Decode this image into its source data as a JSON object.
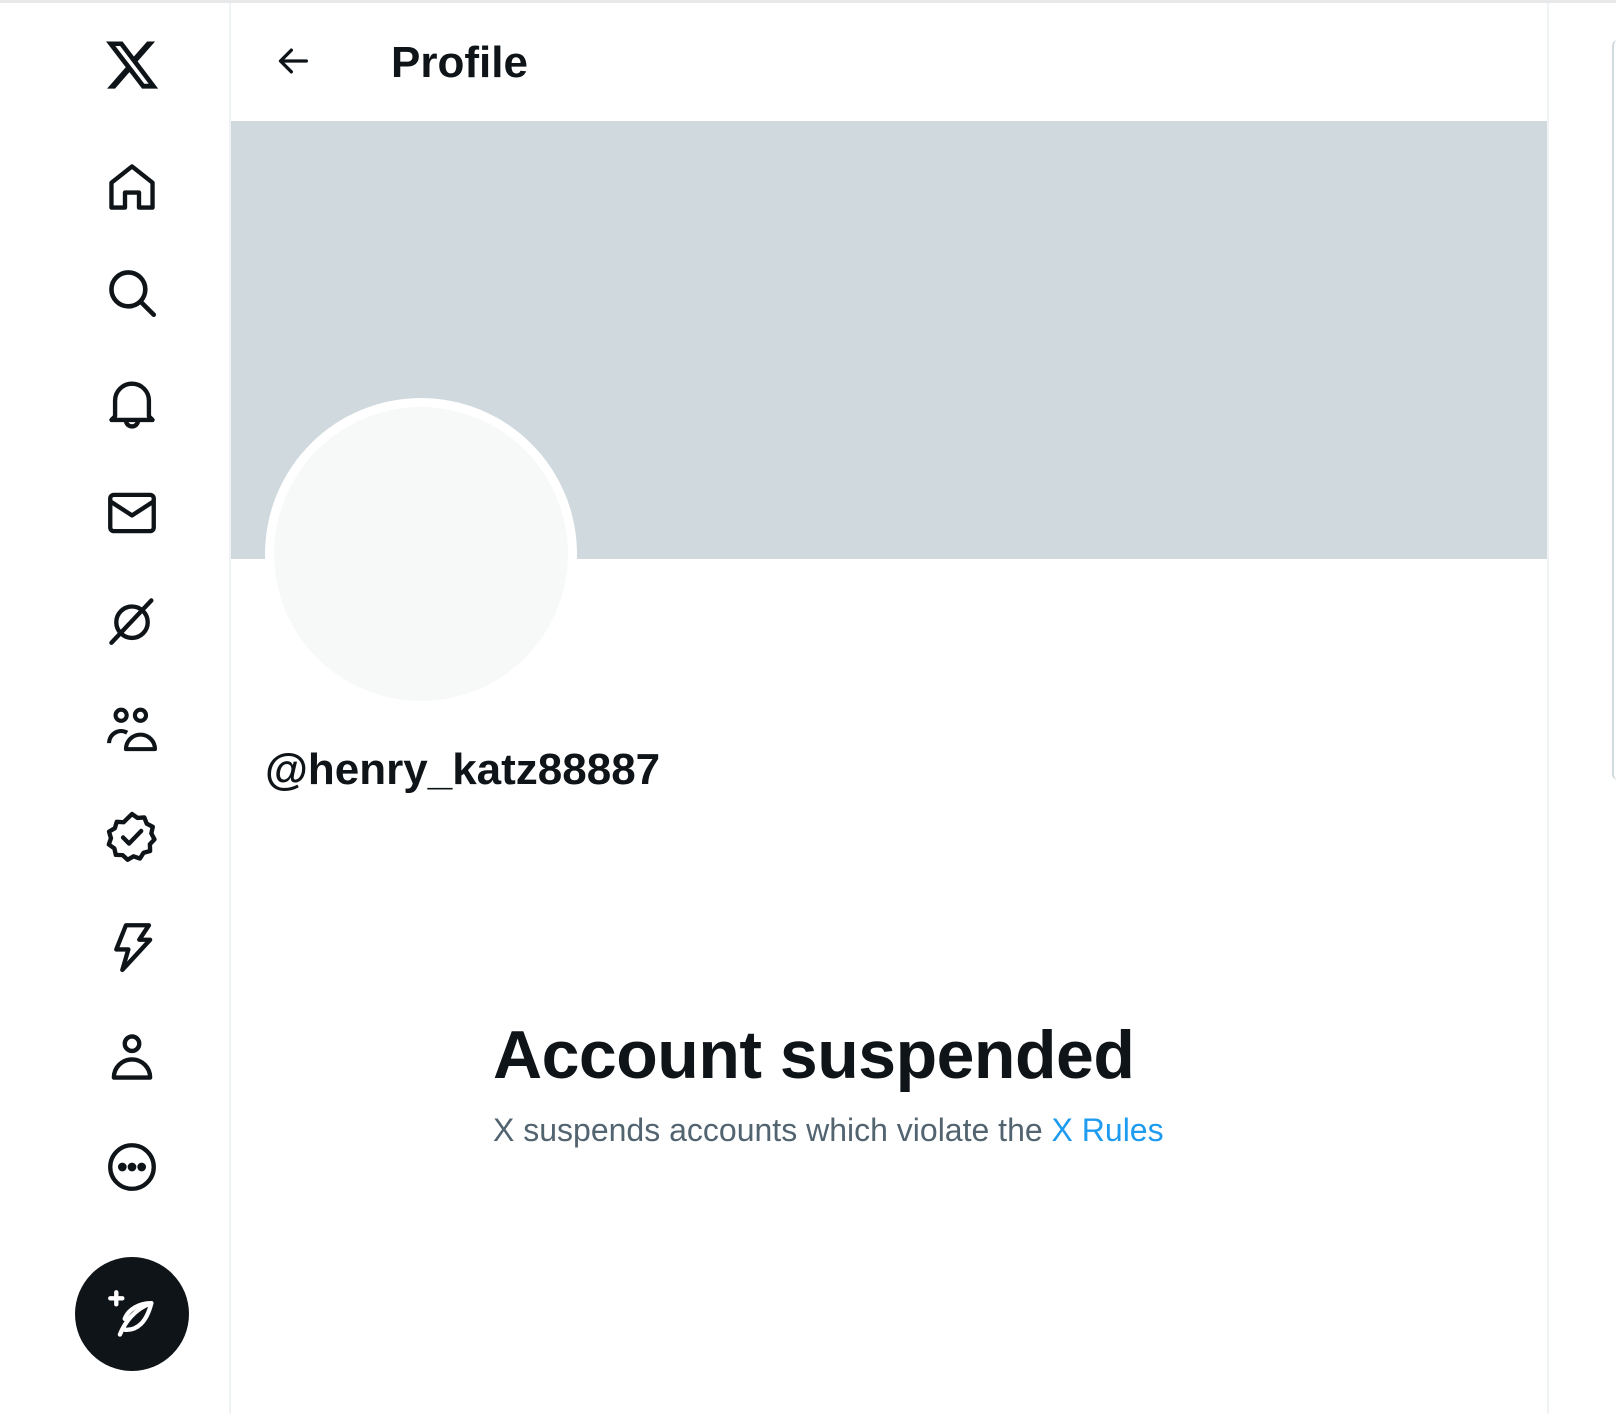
{
  "header": {
    "title": "Profile",
    "back_icon": "arrow-left-icon"
  },
  "nav": {
    "items": [
      {
        "name": "x-logo",
        "icon": "x-logo-icon"
      },
      {
        "name": "home",
        "icon": "home-icon"
      },
      {
        "name": "explore",
        "icon": "search-icon"
      },
      {
        "name": "notifications",
        "icon": "bell-icon"
      },
      {
        "name": "messages",
        "icon": "envelope-icon"
      },
      {
        "name": "grok",
        "icon": "grok-icon"
      },
      {
        "name": "communities",
        "icon": "people-icon"
      },
      {
        "name": "premium",
        "icon": "verified-badge-icon"
      },
      {
        "name": "verified-orgs",
        "icon": "lightning-icon"
      },
      {
        "name": "profile",
        "icon": "person-icon"
      },
      {
        "name": "more",
        "icon": "more-circle-icon"
      }
    ],
    "compose_icon": "feather-plus-icon"
  },
  "profile": {
    "handle": "@henry_katz88887",
    "banner_color": "#cfd9de",
    "avatar_color": "#f7f9f9"
  },
  "notice": {
    "title": "Account suspended",
    "text": "X suspends accounts which violate the ",
    "link_text": "X Rules"
  },
  "colors": {
    "text_primary": "#0f1419",
    "text_secondary": "#536471",
    "link": "#1d9bf0"
  }
}
